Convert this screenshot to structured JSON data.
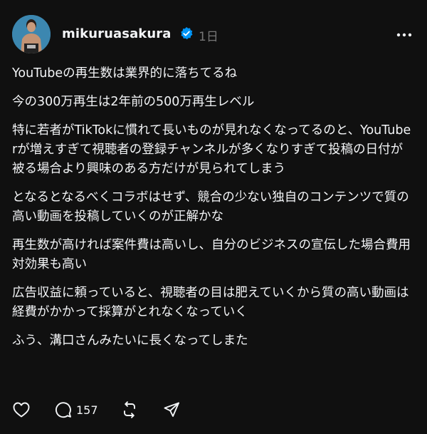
{
  "post": {
    "username": "mikuruasakura",
    "time": "1日",
    "paragraphs": [
      "YouTubeの再生数は業界的に落ちてるね",
      "今の300万再生は2年前の500万再生レベル",
      "特に若者がTikTokに慣れて長いものが見れなくなってるのと、YouTuberが増えすぎて視聴者の登録チャンネルが多くなりすぎて投稿の日付が被る場合より興味のある方だけが見られてしまう",
      "となるとなるべくコラボはせず、競合の少ない独自のコンテンツで質の高い動画を投稿していくのが正解かな",
      "再生数が高ければ案件費は高いし、自分のビジネスの宣伝した場合費用対効果も高い",
      "広告収益に頼っていると、視聴者の目は肥えていくから質の高い動画は経費がかかって採算がとれなくなっていく",
      "ふう、溝口さんみたいに長くなってしまた"
    ],
    "reply_count": "157"
  },
  "colors": {
    "background": "#101010",
    "text": "#f3f5f7",
    "muted": "#777777",
    "verified": "#0095f6"
  },
  "icons": {
    "like": "heart-icon",
    "reply": "comment-icon",
    "repost": "repost-icon",
    "share": "share-icon",
    "more": "more-icon",
    "verified": "verified-badge-icon"
  }
}
